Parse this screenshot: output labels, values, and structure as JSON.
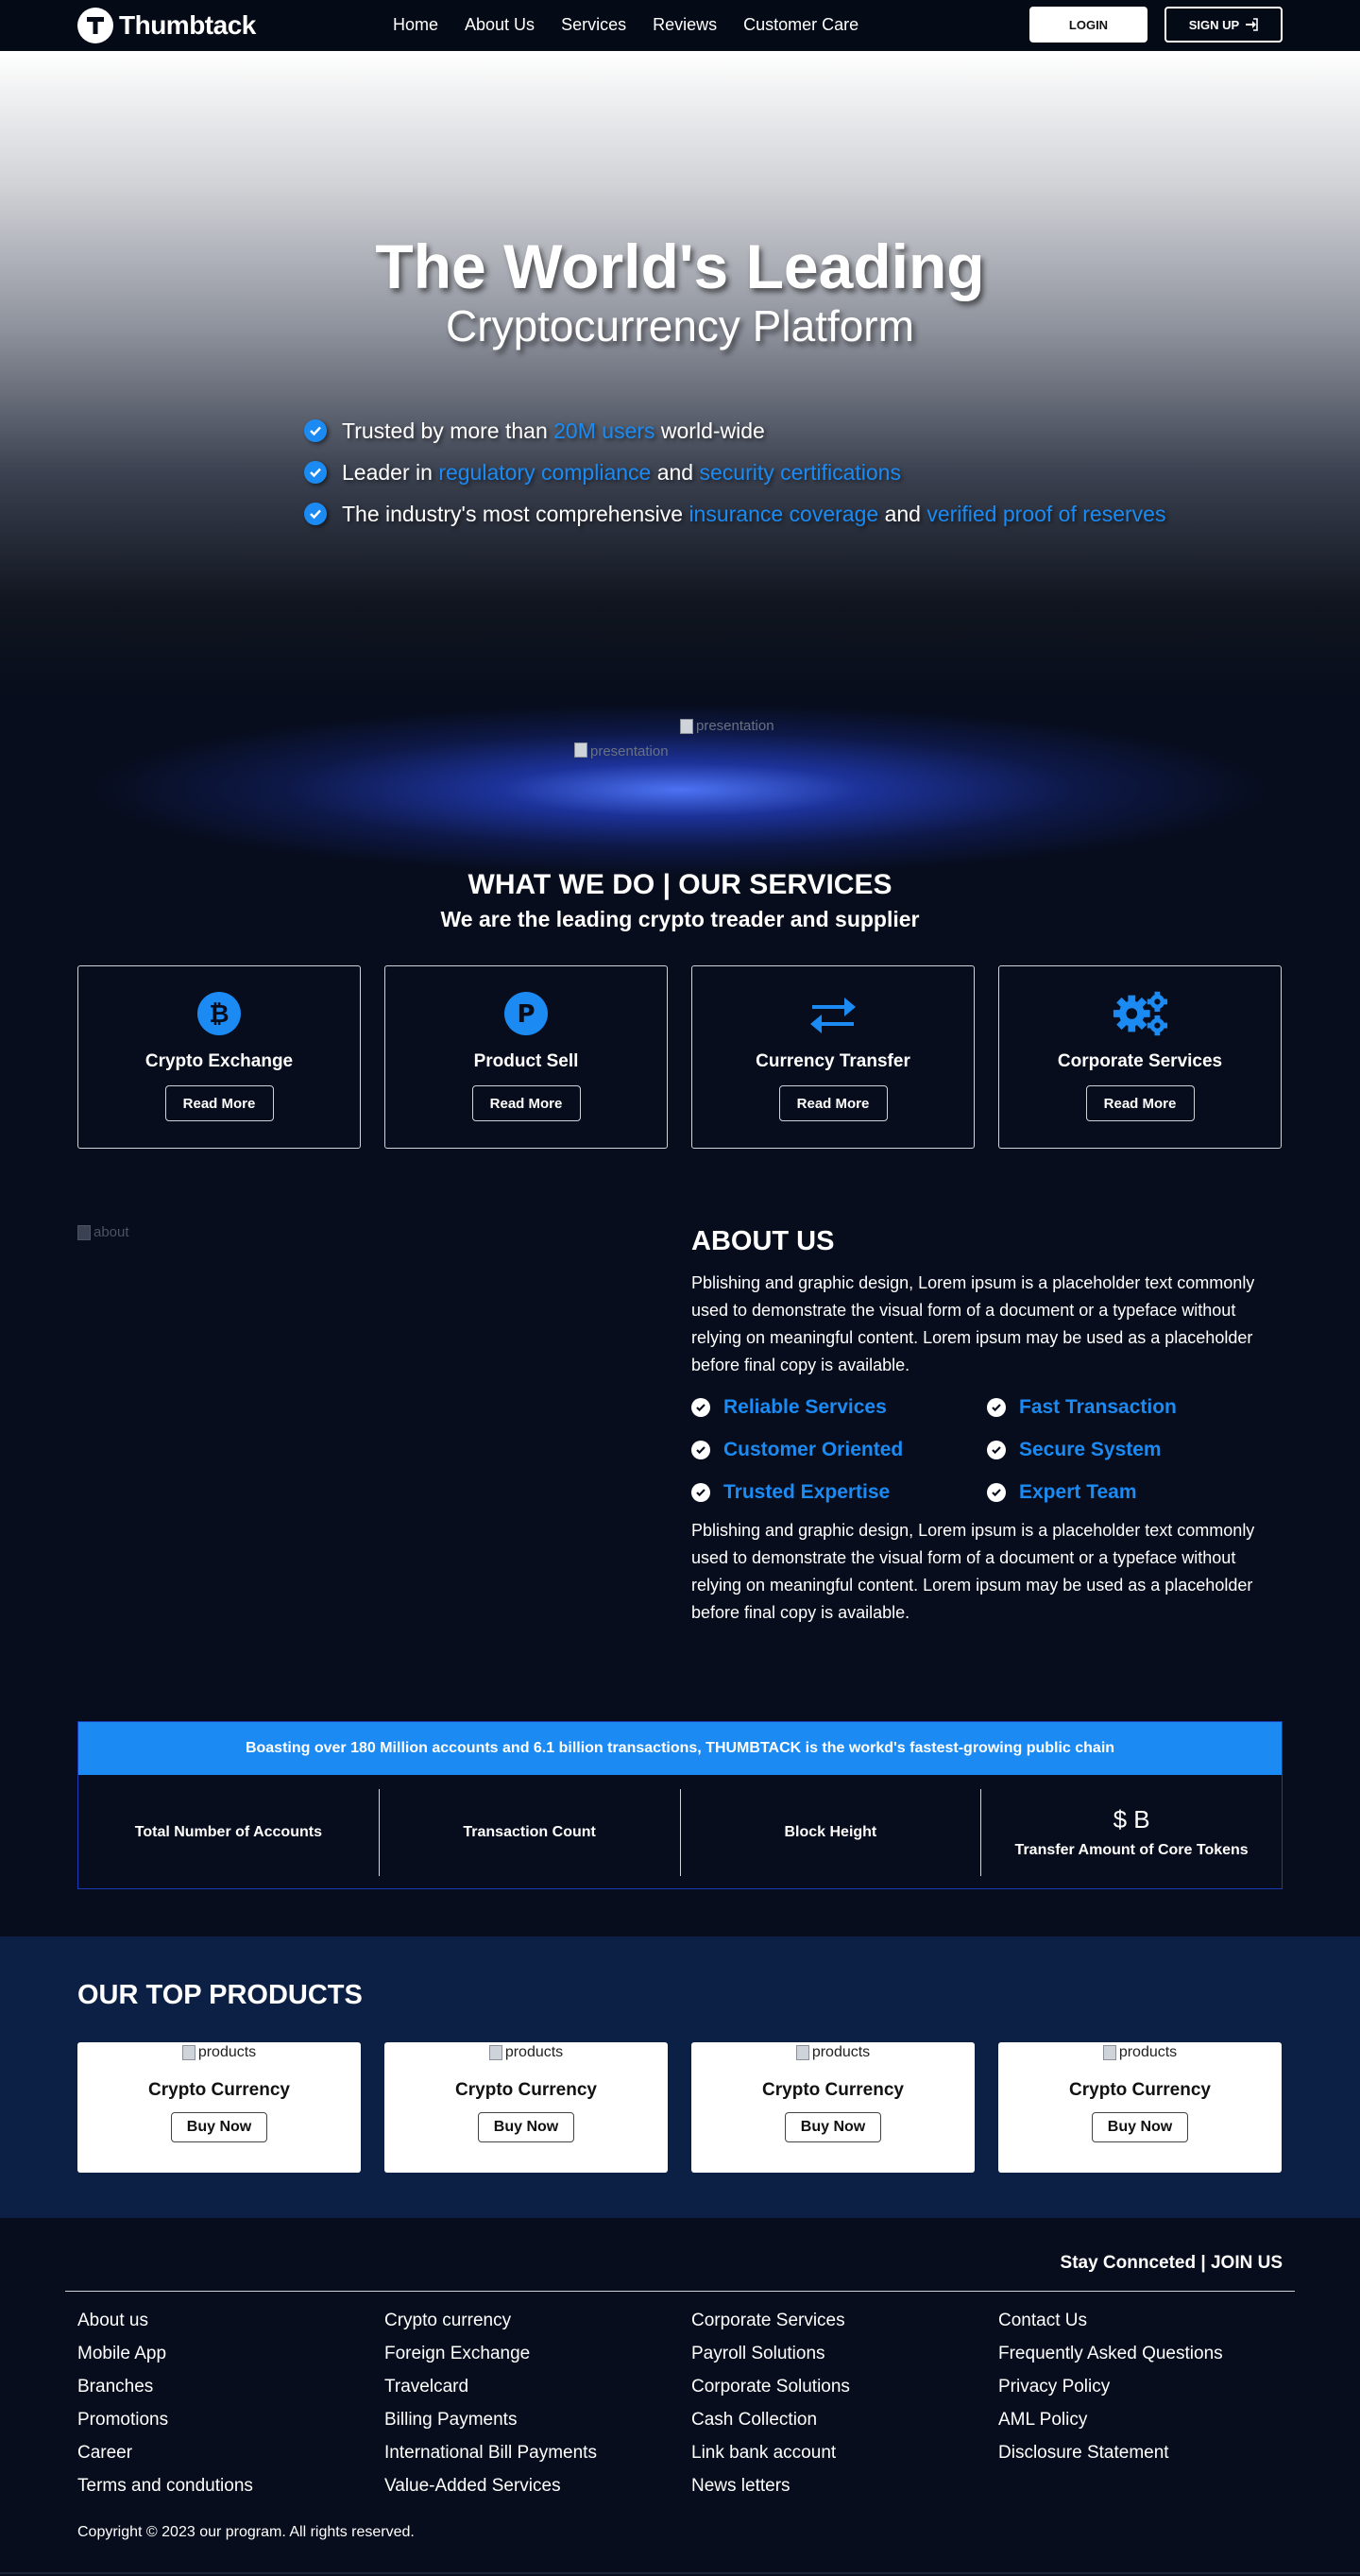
{
  "nav": {
    "brand": "Thumbtack",
    "links": [
      "Home",
      "About Us",
      "Services",
      "Reviews",
      "Customer Care"
    ],
    "login": "LOGIN",
    "signup": "SIGN UP"
  },
  "hero": {
    "title": "The World's Leading",
    "subtitle": "Cryptocurrency Platform",
    "bullets": [
      {
        "pre": "Trusted by more than ",
        "hl1": "20M users",
        "mid": " world-wide",
        "hl2": "",
        "post": ""
      },
      {
        "pre": "Leader in ",
        "hl1": "regulatory compliance",
        "mid": " and ",
        "hl2": "security certifications",
        "post": ""
      },
      {
        "pre": "The industry's most comprehensive ",
        "hl1": "insurance coverage",
        "mid": " and ",
        "hl2": "verified proof of reserves",
        "post": ""
      }
    ],
    "img_alt_1": "presentation",
    "img_alt_2": "presentation"
  },
  "services": {
    "title": "WHAT WE DO | OUR SERVICES",
    "subtitle": "We are the leading crypto treader and supplier",
    "cards": [
      {
        "title": "Crypto Exchange",
        "button": "Read More",
        "icon": "bitcoin-icon"
      },
      {
        "title": "Product Sell",
        "button": "Read More",
        "icon": "product-hunt-icon"
      },
      {
        "title": "Currency Transfer",
        "button": "Read More",
        "icon": "exchange-arrows-icon"
      },
      {
        "title": "Corporate Services",
        "button": "Read More",
        "icon": "gears-icon"
      }
    ]
  },
  "about": {
    "img_alt": "about",
    "title": "ABOUT US",
    "paragraph1": "Pblishing and graphic design, Lorem ipsum is a placeholder text commonly used to demonstrate the visual form of a document or a typeface without relying on meaningful content. Lorem ipsum may be used as a placeholder before final copy is available.",
    "features": [
      "Reliable Services",
      "Fast Transaction",
      "Customer Oriented",
      "Secure System",
      "Trusted Expertise",
      "Expert Team"
    ],
    "paragraph2": "Pblishing and graphic design, Lorem ipsum is a placeholder text commonly used to demonstrate the visual form of a document or a typeface without relying on meaningful content. Lorem ipsum may be used as a placeholder before final copy is available."
  },
  "stats": {
    "banner": "Boasting over 180 Million accounts and 6.1 billion transactions, THUMBTACK is the workd's fastest-growing public chain",
    "items": [
      {
        "value": "",
        "label": "Total Number of Accounts"
      },
      {
        "value": "",
        "label": "Transaction Count"
      },
      {
        "value": "",
        "label": "Block Height"
      },
      {
        "value": "$ B",
        "label": "Transfer Amount of Core Tokens"
      }
    ]
  },
  "products": {
    "title": "OUR TOP PRODUCTS",
    "items": [
      {
        "img_alt": "products",
        "name": "Crypto Currency",
        "button": "Buy Now"
      },
      {
        "img_alt": "products",
        "name": "Crypto Currency",
        "button": "Buy Now"
      },
      {
        "img_alt": "products",
        "name": "Crypto Currency",
        "button": "Buy Now"
      },
      {
        "img_alt": "products",
        "name": "Crypto Currency",
        "button": "Buy Now"
      }
    ]
  },
  "footer": {
    "join": "Stay Connceted | JOIN US",
    "columns": [
      [
        "About us",
        "Mobile App",
        "Branches",
        "Promotions",
        "Career",
        "Terms and condutions"
      ],
      [
        "Crypto currency",
        "Foreign Exchange",
        "Travelcard",
        "Billing Payments",
        "International Bill Payments",
        "Value-Added Services"
      ],
      [
        "Corporate Services",
        "Payroll Solutions",
        "Corporate Solutions",
        "Cash Collection",
        "Link bank account",
        "News letters"
      ],
      [
        "Contact Us",
        "Frequently Asked Questions",
        "Privacy Policy",
        "AML Policy",
        "Disclosure Statement"
      ]
    ],
    "copyright": "Copyright © 2023 our program. All rights reserved."
  },
  "colors": {
    "accent": "#1b8bf3",
    "background": "#070d1c",
    "products_bg": "#0c1f44"
  }
}
